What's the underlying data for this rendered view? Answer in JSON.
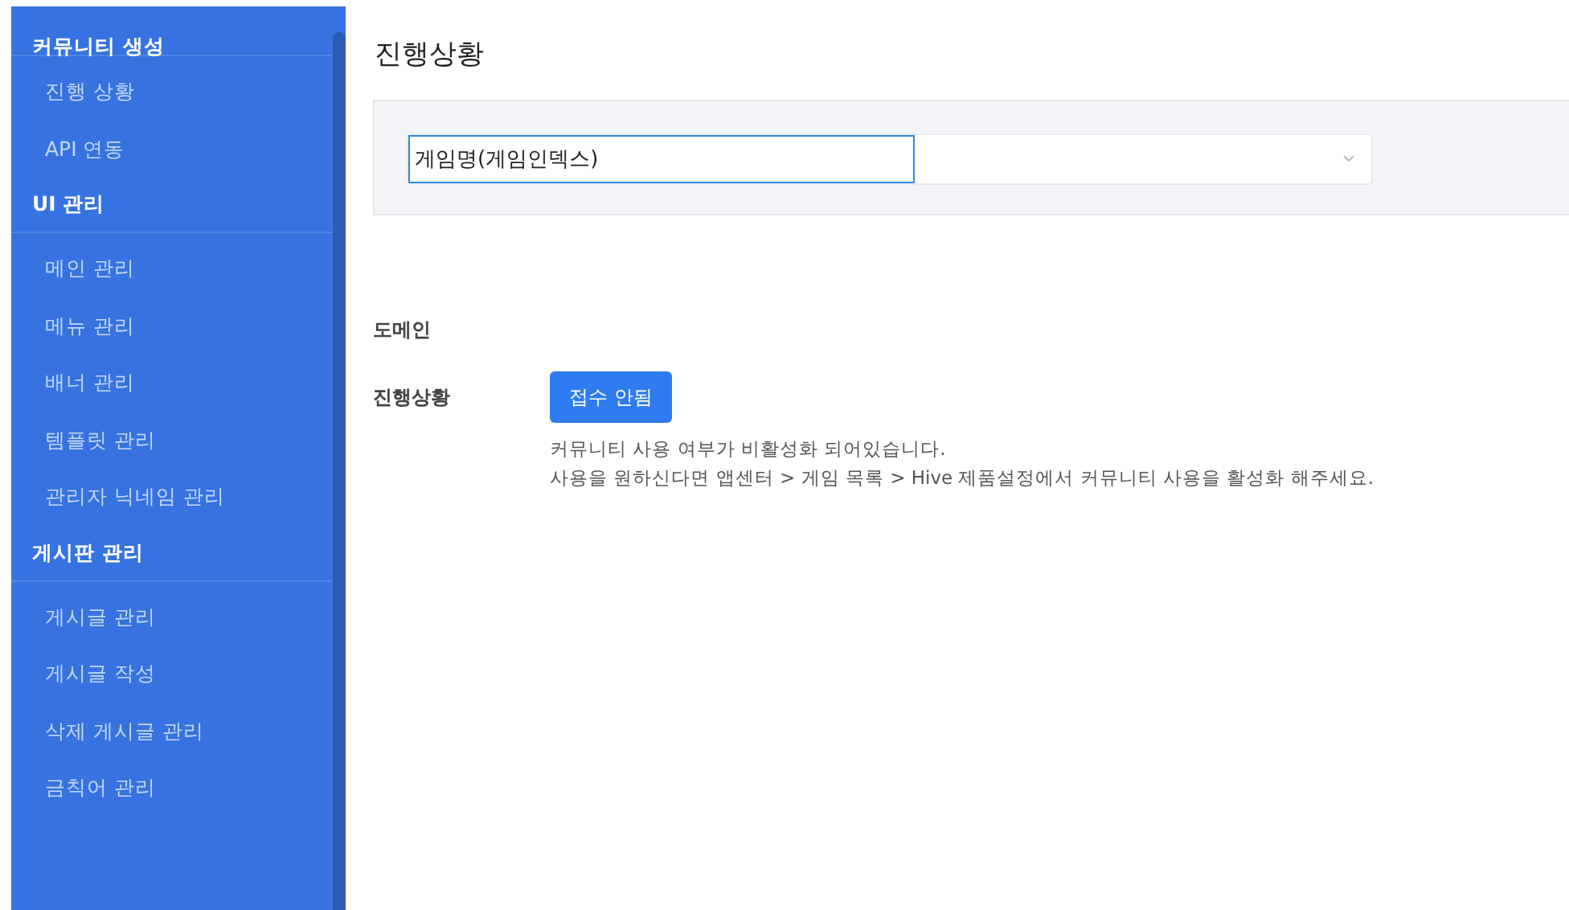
{
  "sidebar": {
    "groups": [
      {
        "title": "커뮤니티 생성",
        "items": [
          "진행 상황",
          "API 연동"
        ]
      },
      {
        "title": "UI 관리",
        "items": [
          "메인 관리",
          "메뉴 관리",
          "배너 관리",
          "템플릿 관리",
          "관리자 닉네임 관리"
        ]
      },
      {
        "title": "게시판 관리",
        "items": [
          "게시글 관리",
          "게시글 작성",
          "삭제 게시글 관리",
          "금칙어 관리"
        ]
      }
    ]
  },
  "page_title": "진행상황",
  "game_select": {
    "value": "게임명(게임인덱스)"
  },
  "fields": [
    {
      "label": "도메인"
    },
    {
      "label": "진행상황",
      "button": "접수 안됨",
      "message": [
        "커뮤니티 사용 여부가 비활성화 되어있습니다.",
        "사용을 원하신다면 앱센터 > 게임 목록 > Hive 제품설정에서 커뮤니티 사용을 활성화 해주세요."
      ]
    }
  ]
}
